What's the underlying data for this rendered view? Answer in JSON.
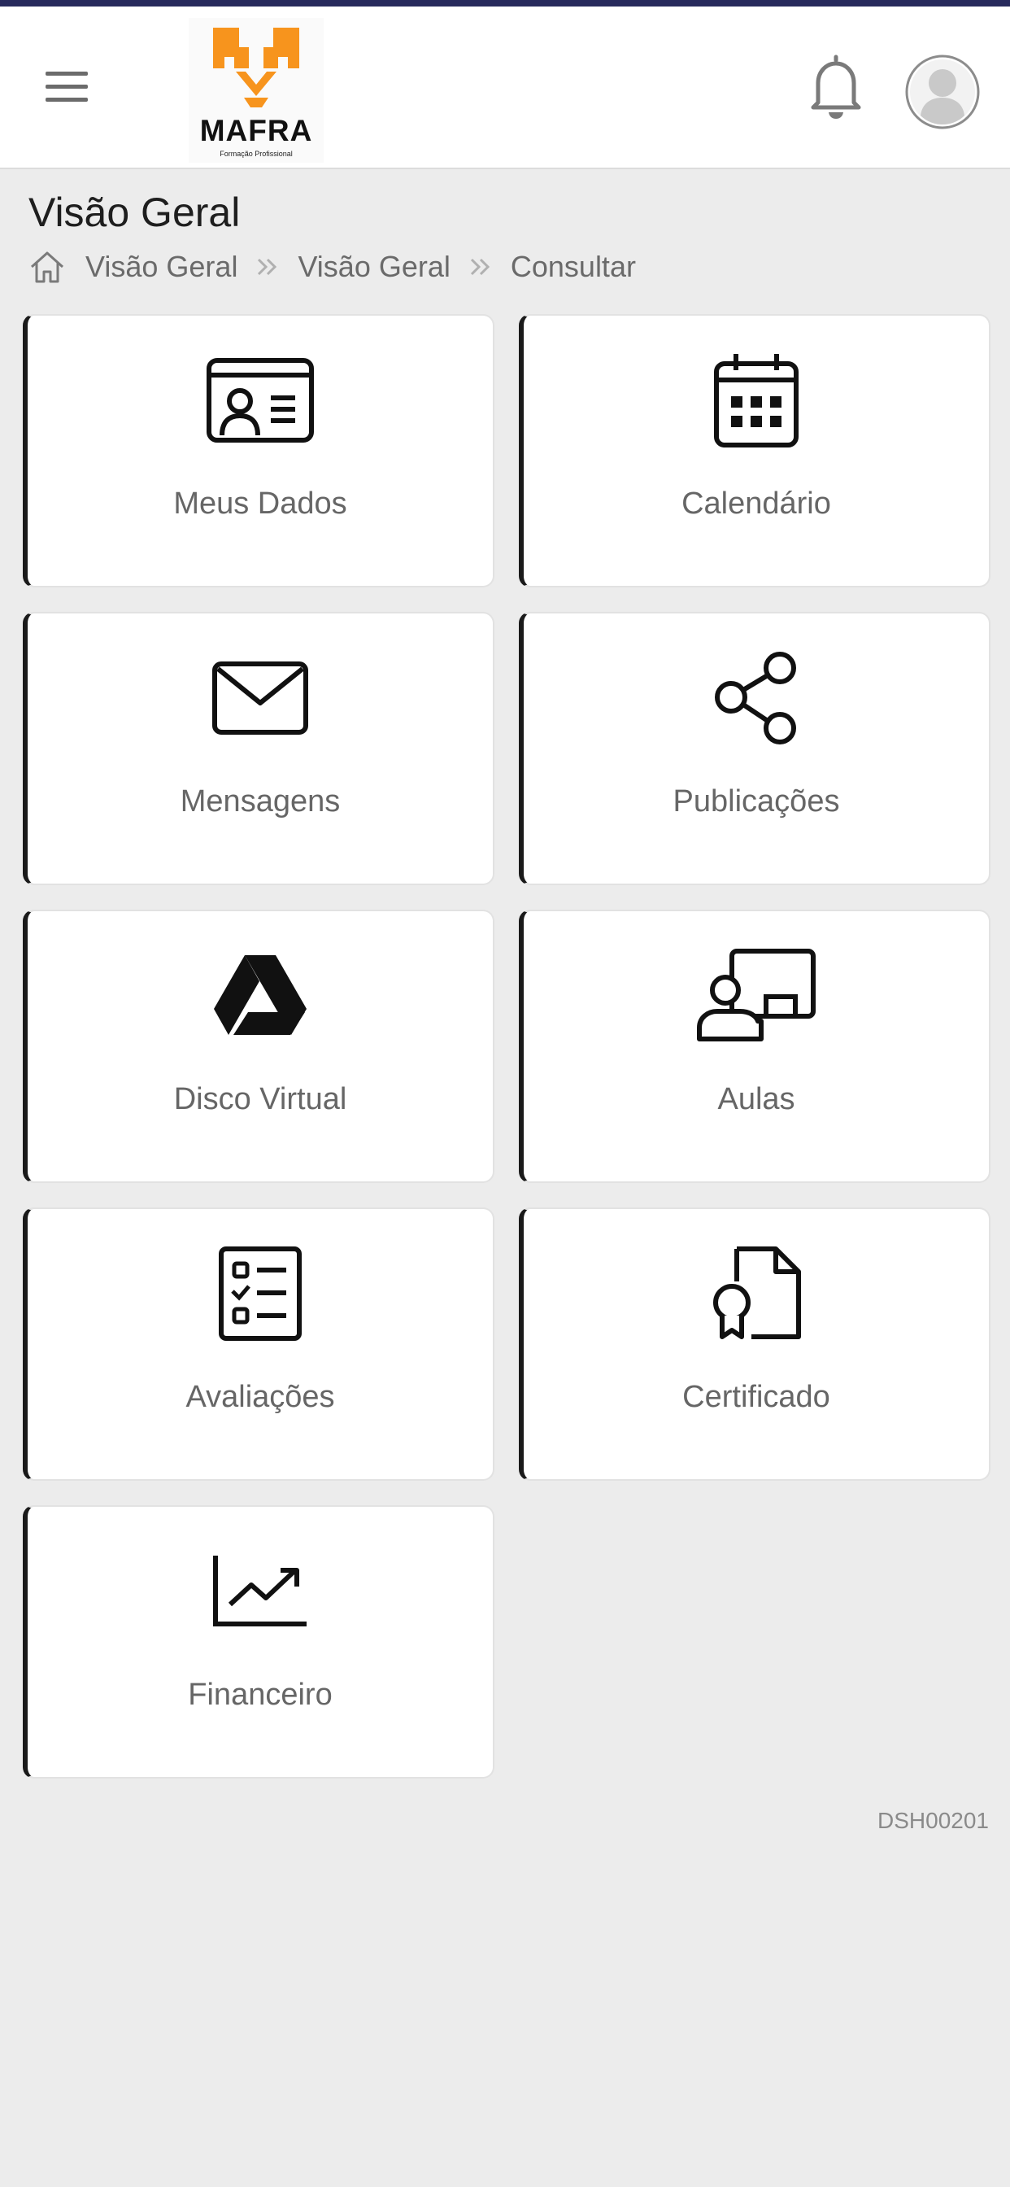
{
  "header": {
    "logo_text": "MAFRA",
    "logo_subtitle": "Formação Profissional",
    "colors": {
      "accent_bar": "#272a5c",
      "logo_orange": "#f7941d"
    }
  },
  "page": {
    "title": "Visão Geral",
    "breadcrumb": [
      "Visão Geral",
      "Visão Geral",
      "Consultar"
    ]
  },
  "tiles": [
    {
      "label": "Meus Dados",
      "icon": "id-card-icon"
    },
    {
      "label": "Calendário",
      "icon": "calendar-icon"
    },
    {
      "label": "Mensagens",
      "icon": "envelope-icon"
    },
    {
      "label": "Publicações",
      "icon": "share-icon"
    },
    {
      "label": "Disco Virtual",
      "icon": "drive-icon"
    },
    {
      "label": "Aulas",
      "icon": "teacher-board-icon"
    },
    {
      "label": "Avaliações",
      "icon": "checklist-icon"
    },
    {
      "label": "Certificado",
      "icon": "certificate-icon"
    },
    {
      "label": "Financeiro",
      "icon": "trending-chart-icon"
    }
  ],
  "footer": {
    "code": "DSH00201"
  }
}
